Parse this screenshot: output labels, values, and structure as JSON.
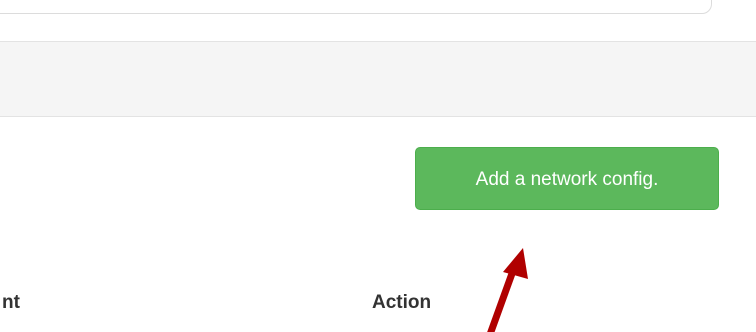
{
  "toolbar": {
    "add_label": "Add a network config."
  },
  "table": {
    "columns": [
      "nt",
      "Action"
    ]
  },
  "annotation": {
    "arrow_color": "#b00000"
  },
  "colors": {
    "button_green": "#5cb85c",
    "bar_grey": "#f5f5f5"
  }
}
